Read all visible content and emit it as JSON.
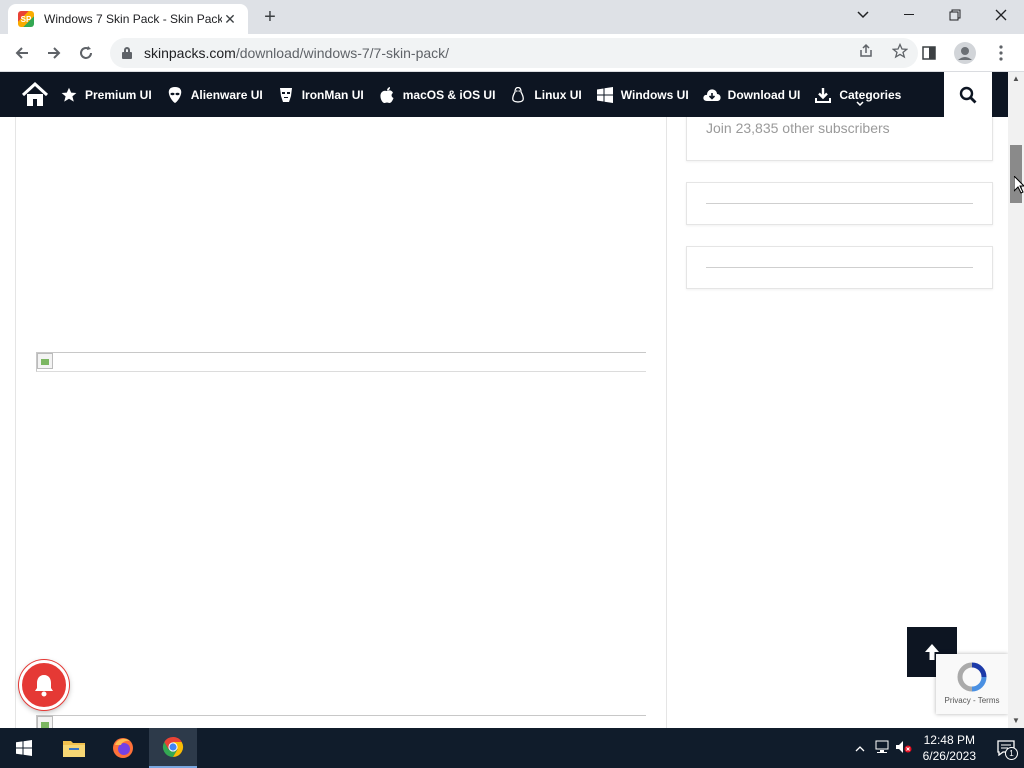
{
  "browser": {
    "tab_title": "Windows 7 Skin Pack - Skin Pack",
    "favicon_text": "SP",
    "url_host": "skinpacks.com",
    "url_path": "/download/windows-7/7-skin-pack/"
  },
  "nav": {
    "items": [
      {
        "label": "Premium UI",
        "icon": "star-icon"
      },
      {
        "label": "Alienware UI",
        "icon": "alien-icon"
      },
      {
        "label": "IronMan UI",
        "icon": "transformer-icon"
      },
      {
        "label": "macOS & iOS UI",
        "icon": "apple-icon"
      },
      {
        "label": "Linux UI",
        "icon": "linux-icon"
      },
      {
        "label": "Windows UI",
        "icon": "windows-icon"
      },
      {
        "label": "Download UI",
        "icon": "cloud-download-icon"
      },
      {
        "label": "Categories",
        "icon": "download-icon"
      }
    ]
  },
  "sidebar": {
    "subscribers_text": "Join 23,835 other subscribers"
  },
  "recaptcha": {
    "privacy": "Privacy",
    "separator": " - ",
    "terms": "Terms"
  },
  "taskbar": {
    "time": "12:48 PM",
    "date": "6/26/2023",
    "notification_count": "1"
  },
  "colors": {
    "nav_bg": "#0d1522",
    "bell": "#e53935",
    "taskbar": "#101c2b"
  }
}
